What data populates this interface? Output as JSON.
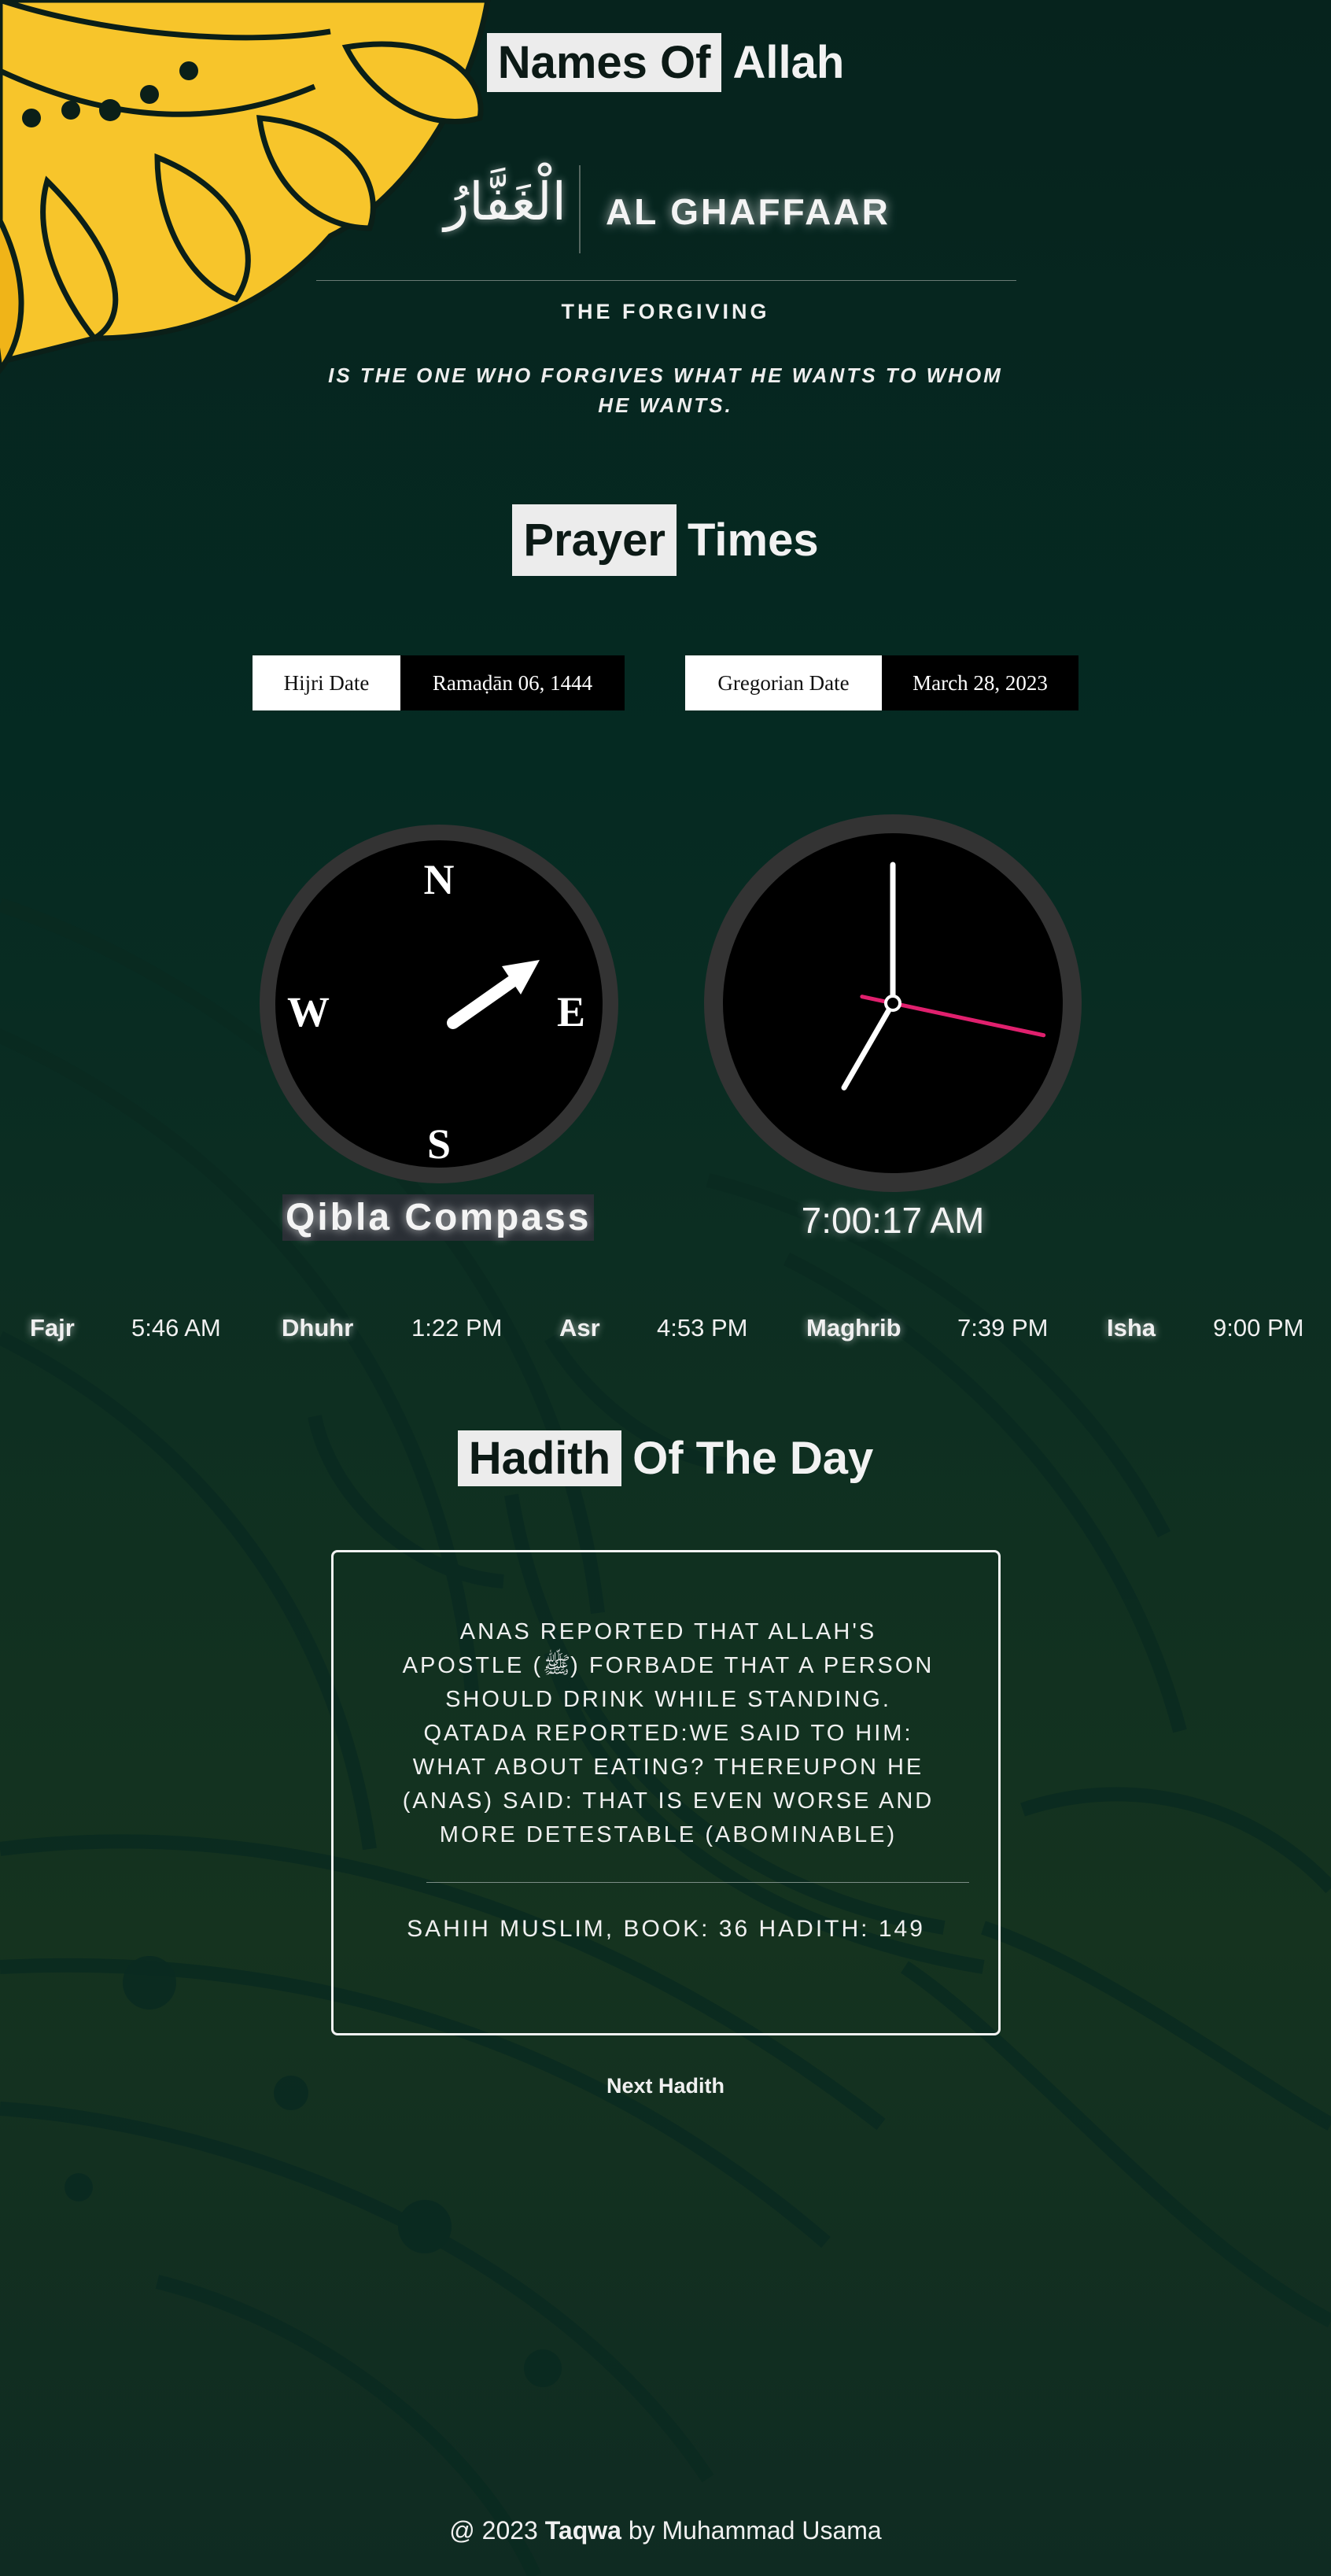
{
  "names_section": {
    "heading_highlight": "Names Of",
    "heading_rest": "Allah",
    "arabic_name": "الْغَفَّارُ",
    "english_name": "AL GHAFFAAR",
    "meaning": "THE FORGIVING",
    "description": "IS THE ONE WHO FORGIVES WHAT HE WANTS TO WHOM HE WANTS."
  },
  "prayer_section": {
    "heading_highlight": "Prayer",
    "heading_rest": "Times",
    "hijri_label": "Hijri Date",
    "hijri_value": "Ramaḍān 06, 1444",
    "gregorian_label": "Gregorian Date",
    "gregorian_value": "March 28, 2023",
    "compass": {
      "north": "N",
      "south": "S",
      "east": "E",
      "west": "W",
      "label": "Qibla Compass"
    },
    "clock": {
      "time_text": "7:00:17 AM",
      "hour_hand_deg": 210,
      "minute_hand_deg": 0,
      "second_hand_deg": 102
    },
    "times": [
      {
        "name": "Fajr",
        "time": "5:46 AM"
      },
      {
        "name": "Dhuhr",
        "time": "1:22 PM"
      },
      {
        "name": "Asr",
        "time": "4:53 PM"
      },
      {
        "name": "Maghrib",
        "time": "7:39 PM"
      },
      {
        "name": "Isha",
        "time": "9:00 PM"
      }
    ]
  },
  "hadith_section": {
    "heading_highlight": "Hadith",
    "heading_rest": "Of The Day",
    "text": "ANAS REPORTED THAT ALLAH'S APOSTLE (ﷺ) FORBADE THAT A PERSON SHOULD DRINK WHILE STANDING. QATADA REPORTED:WE SAID TO HIM: WHAT ABOUT EATING? THEREUPON HE (ANAS) SAID: THAT IS EVEN WORSE AND MORE DETESTABLE (ABOMINABLE)",
    "reference": "SAHIH MUSLIM, BOOK: 36 HADITH: 149",
    "next_button": "Next Hadith"
  },
  "footer": {
    "prefix": "@ 2023",
    "brand": "Taqwa",
    "by": "by",
    "author": "Muhammad Usama"
  },
  "colors": {
    "accent_yellow": "#f7c52b",
    "clock_second_hand": "#e0206e",
    "background_dark": "#06231d"
  }
}
